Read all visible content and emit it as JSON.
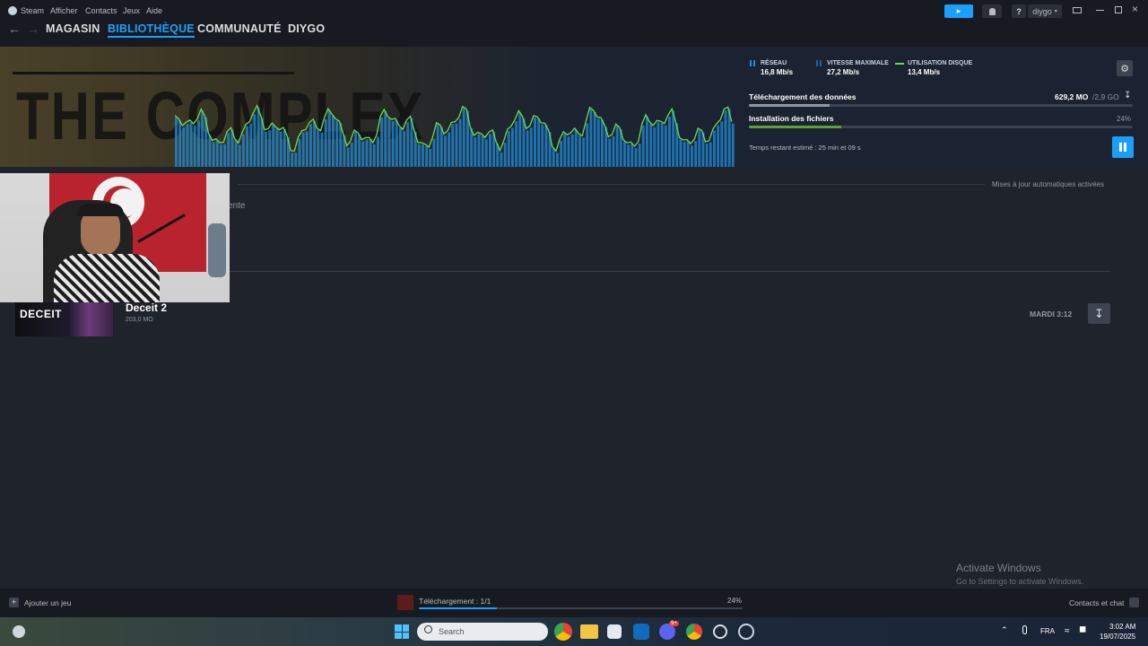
{
  "menu": {
    "app": "Steam",
    "items": [
      "Afficher",
      "Contacts",
      "Jeux",
      "Aide"
    ],
    "user": "diygo"
  },
  "nav": {
    "store": "MAGASIN",
    "library": "BIBLIOTHÈQUE",
    "community": "COMMUNAUTÉ",
    "profile": "DIYGO"
  },
  "header": {
    "hero_text": "THE COMPLEX",
    "stats": {
      "network_label": "RÉSEAU",
      "network_value": "16,8 Mb/s",
      "peak_label": "VITESSE MAXIMALE",
      "peak_value": "27,2 Mb/s",
      "disk_label": "UTILISATION DISQUE",
      "disk_value": "13,4 Mb/s"
    },
    "download_label": "Téléchargement des données",
    "download_done": "629,2 MO",
    "download_total": "/2,9 GO",
    "download_fraction": 0.21,
    "install_label": "Installation des fichiers",
    "install_percent_text": "24%",
    "install_fraction": 0.24,
    "time_remaining": "Temps restant estimé : 25 min et 09 s"
  },
  "main": {
    "auto_updates": "Mises à jour automatiques activées",
    "partial_text": "ente",
    "game": {
      "logo": "DECEIT",
      "title": "Deceit 2",
      "size": "203,0 MO",
      "schedule": "MARDI 3:12"
    },
    "activation_title": "Activate Windows",
    "activation_sub": "Go to Settings to activate Windows."
  },
  "bottom": {
    "add_game": "Ajouter un jeu",
    "download_status": "Téléchargement : 1/1",
    "download_percent": "24%",
    "download_fraction": 0.24,
    "friends": "Contacts et chat"
  },
  "taskbar": {
    "search_placeholder": "Search",
    "lang": "FRA",
    "time": "3:02 AM",
    "date": "19/07/2025",
    "discord_badge": "9+"
  },
  "colors": {
    "accent": "#1a9fff",
    "network_bar": "#1f8fdf",
    "disk_line": "#6bdb4f",
    "install_fill": "#5ba32b"
  },
  "icons": [
    "steam-icon",
    "back-arrow-icon",
    "forward-arrow-icon",
    "announcement-icon",
    "bell-icon",
    "help-icon",
    "big-picture-icon",
    "minimize-icon",
    "maximize-icon",
    "close-icon",
    "settings-icon",
    "pause-icon",
    "download-icon",
    "plus-icon",
    "chat-icon",
    "windows-start-icon",
    "search-icon",
    "chrome-icon",
    "folder-icon",
    "store-icon",
    "outlook-icon",
    "discord-icon",
    "steam-taskbar-icon",
    "wifi-icon",
    "volume-icon",
    "mic-icon",
    "chevron-up-icon"
  ]
}
